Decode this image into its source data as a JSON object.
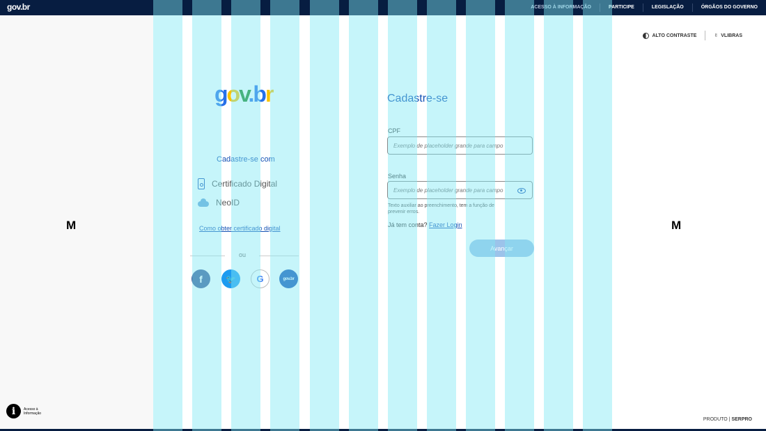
{
  "topbar": {
    "logo": "gov.br",
    "nav": [
      "ACESSO À INFORMAÇÃO",
      "PARTICIPE",
      "LEGISLAÇÃO",
      "ÓRGÃOS DO GOVERNO"
    ]
  },
  "accessibility": {
    "contrast": "ALTO CONTRASTE",
    "vlibras": "VLIBRAS"
  },
  "gutter": {
    "left_letter": "M",
    "right_letter": "M"
  },
  "brand": {
    "logo": "gov.br"
  },
  "signup": {
    "with_label": "Cadastre-se com",
    "options": [
      "Certificado Digital",
      "NeoID"
    ],
    "cert_link": "Como obter certificado digital",
    "or": "ou",
    "social": [
      {
        "name": "facebook",
        "glyph": "f"
      },
      {
        "name": "twitter",
        "glyph": "🐦"
      },
      {
        "name": "google",
        "glyph": "G"
      },
      {
        "name": "govbr",
        "glyph": "gov.br"
      }
    ]
  },
  "form": {
    "title": "Cadastre-se",
    "cpf_label": "CPF",
    "cpf_placeholder": "Exemplo de placeholder grande para campo",
    "password_label": "Senha",
    "password_placeholder": "Exemplo de placeholder grande para campo",
    "helper": "Texto auxiliar ao preenchimento, tem a função de prevenir erros.",
    "have_account": "Já tem conta?",
    "login_link": "Fazer Login",
    "submit": "Avançar"
  },
  "footer": {
    "access_info_line1": "Acesso à",
    "access_info_line2": "Informação",
    "product_prefix": "PRODUTO |",
    "product_brand": "SERPRO"
  },
  "colors": {
    "topbar": "#071d41",
    "primary": "#1351b4",
    "grid_overlay": "#80e8f4"
  }
}
